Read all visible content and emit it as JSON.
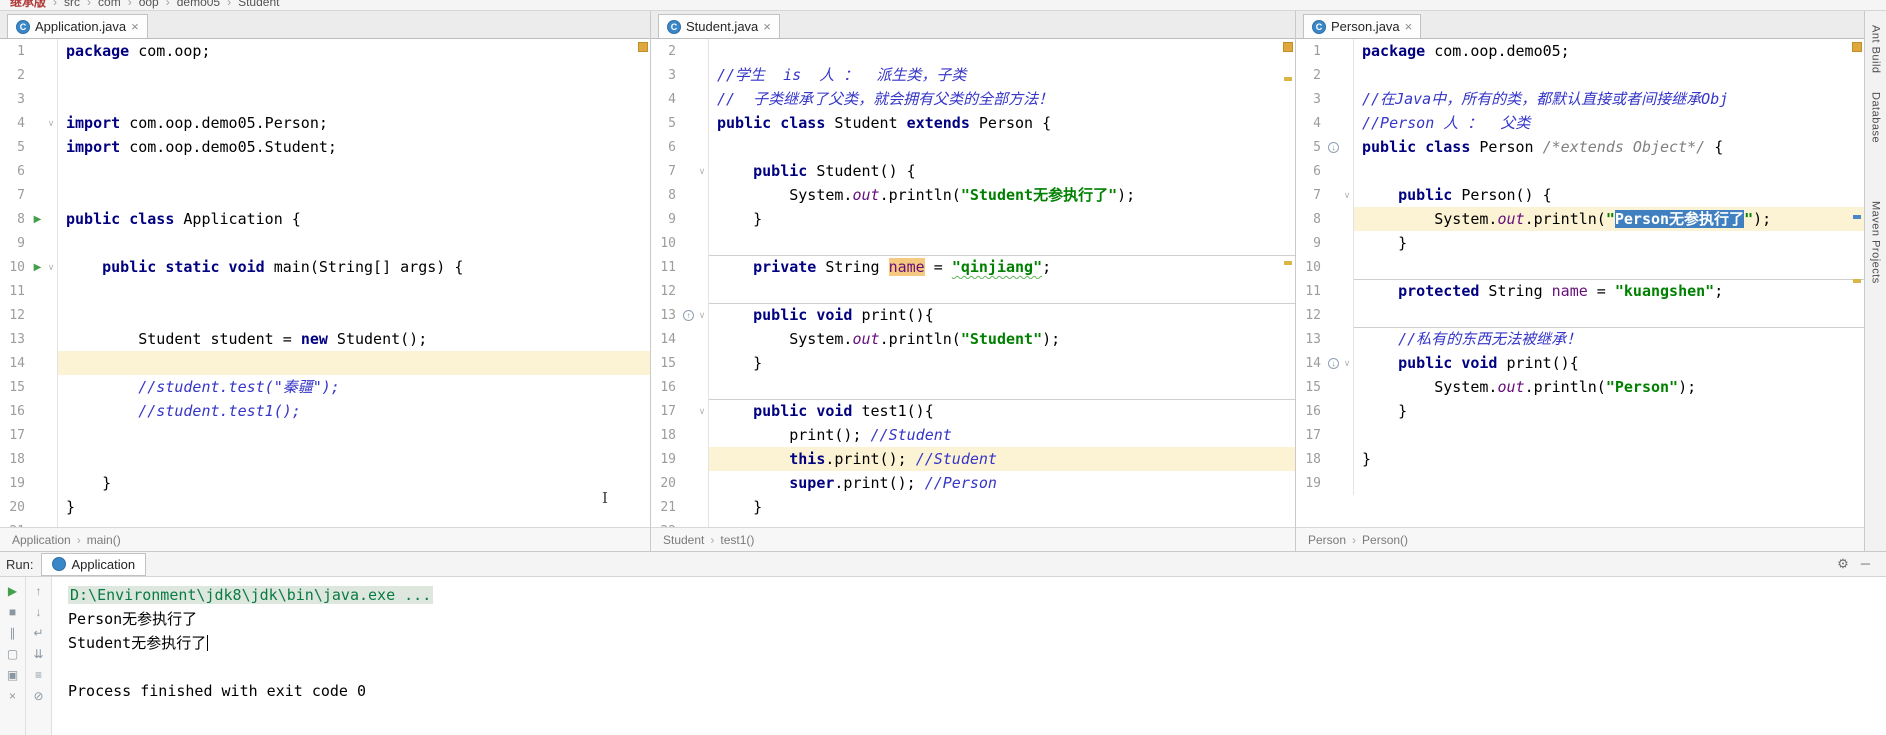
{
  "theme": {
    "keyword_color": "#000080",
    "string_color": "#008000",
    "comment_color": "#3535c8",
    "field_color": "#660e7a",
    "selection_bg": "#4180c0",
    "current_line_bg": "#fcf3d4",
    "identifier_highlight_bg": "#f5c97f",
    "inspection_status_color": "#e0a83c",
    "console_command_color": "#0a7a43"
  },
  "icons": {
    "close": "×",
    "chevron": "›",
    "fold": "∨",
    "gear": "⚙",
    "hide": "─",
    "class_glyph": "C"
  },
  "top_nav": {
    "items": [
      "继承版",
      "src",
      "com",
      "oop",
      "demo05",
      "Student"
    ]
  },
  "gutter_glyphs": {
    "run": "▶",
    "override": "↑",
    "subclass": "↓",
    "overridden": "↓"
  },
  "panes": [
    {
      "tab": "Application.java",
      "start": 1,
      "current_line": 14,
      "breadcrumb": [
        "Application",
        "main()"
      ],
      "gutter_icons": {
        "8": "run",
        "10": "run"
      },
      "folds": [
        4,
        10
      ],
      "separators": [],
      "lines": [
        [
          {
            "t": "package",
            "c": "kw"
          },
          {
            "t": " com.oop;",
            "c": "pl"
          }
        ],
        [],
        [],
        [
          {
            "t": "import",
            "c": "kw"
          },
          {
            "t": " com.oop.demo05.Person;",
            "c": "pl"
          }
        ],
        [
          {
            "t": "import",
            "c": "kw"
          },
          {
            "t": " com.oop.demo05.Student;",
            "c": "pl"
          }
        ],
        [],
        [],
        [
          {
            "t": "public class",
            "c": "kw"
          },
          {
            "t": " Application {",
            "c": "pl"
          }
        ],
        [],
        [
          {
            "t": "    ",
            "c": "pl"
          },
          {
            "t": "public static void",
            "c": "kw"
          },
          {
            "t": " main(String[] args) {",
            "c": "pl"
          }
        ],
        [],
        [],
        [
          {
            "t": "        Student student = ",
            "c": "pl"
          },
          {
            "t": "new",
            "c": "kw"
          },
          {
            "t": " Student();",
            "c": "pl"
          }
        ],
        [],
        [
          {
            "t": "        ",
            "c": "pl"
          },
          {
            "t": "//student.test(\"秦疆\");",
            "c": "cmt"
          }
        ],
        [
          {
            "t": "        ",
            "c": "pl"
          },
          {
            "t": "//student.test1();",
            "c": "cmt"
          }
        ],
        [],
        [],
        [
          {
            "t": "    }",
            "c": "pl"
          }
        ],
        [
          {
            "t": "}",
            "c": "pl"
          }
        ],
        []
      ]
    },
    {
      "tab": "Student.java",
      "start": 2,
      "current_line": 19,
      "breadcrumb": [
        "Student",
        "test1()"
      ],
      "gutter_icons": {
        "13": "override"
      },
      "folds": [
        7,
        13,
        17
      ],
      "separators": [
        11,
        13,
        17
      ],
      "lines": [
        [],
        [
          {
            "t": "//学生  is  人 ：  派生类，子类",
            "c": "cmt"
          }
        ],
        [
          {
            "t": "//  子类继承了父类，就会拥有父类的全部方法！",
            "c": "cmt"
          }
        ],
        [
          {
            "t": "public class",
            "c": "kw"
          },
          {
            "t": " Student ",
            "c": "pl"
          },
          {
            "t": "extends",
            "c": "kw"
          },
          {
            "t": " Person {",
            "c": "pl"
          }
        ],
        [],
        [
          {
            "t": "    ",
            "c": "pl"
          },
          {
            "t": "public",
            "c": "kw"
          },
          {
            "t": " Student() {",
            "c": "pl"
          }
        ],
        [
          {
            "t": "        System.",
            "c": "pl"
          },
          {
            "t": "out",
            "c": "sfld"
          },
          {
            "t": ".println(",
            "c": "pl"
          },
          {
            "t": "\"Student无参执行了\"",
            "c": "str"
          },
          {
            "t": ");",
            "c": "pl"
          }
        ],
        [
          {
            "t": "    }",
            "c": "pl"
          }
        ],
        [],
        [
          {
            "t": "    ",
            "c": "pl"
          },
          {
            "t": "private",
            "c": "kw"
          },
          {
            "t": " String ",
            "c": "pl"
          },
          {
            "t": "name",
            "c": "hl"
          },
          {
            "t": " = ",
            "c": "pl"
          },
          {
            "t": "\"qinjiang\"",
            "c": "typo"
          },
          {
            "t": ";",
            "c": "pl"
          }
        ],
        [],
        [
          {
            "t": "    ",
            "c": "pl"
          },
          {
            "t": "public void",
            "c": "kw"
          },
          {
            "t": " print(){",
            "c": "pl"
          }
        ],
        [
          {
            "t": "        System.",
            "c": "pl"
          },
          {
            "t": "out",
            "c": "sfld"
          },
          {
            "t": ".println(",
            "c": "pl"
          },
          {
            "t": "\"Student\"",
            "c": "str"
          },
          {
            "t": ");",
            "c": "pl"
          }
        ],
        [
          {
            "t": "    }",
            "c": "pl"
          }
        ],
        [],
        [
          {
            "t": "    ",
            "c": "pl"
          },
          {
            "t": "public void",
            "c": "kw"
          },
          {
            "t": " test1(){",
            "c": "pl"
          }
        ],
        [
          {
            "t": "        print(); ",
            "c": "pl"
          },
          {
            "t": "//Student",
            "c": "cmt"
          }
        ],
        [
          {
            "t": "        ",
            "c": "pl"
          },
          {
            "t": "this",
            "c": "kw"
          },
          {
            "t": ".print(); ",
            "c": "pl"
          },
          {
            "t": "//Student",
            "c": "cmt"
          }
        ],
        [
          {
            "t": "        ",
            "c": "pl"
          },
          {
            "t": "super",
            "c": "kw"
          },
          {
            "t": ".print(); ",
            "c": "pl"
          },
          {
            "t": "//Person",
            "c": "cmt"
          }
        ],
        [
          {
            "t": "    }",
            "c": "pl"
          }
        ],
        []
      ]
    },
    {
      "tab": "Person.java",
      "start": 1,
      "current_line": 8,
      "breadcrumb": [
        "Person",
        "Person()"
      ],
      "gutter_icons": {
        "5": "subclass",
        "14": "overridden"
      },
      "folds": [
        7,
        14
      ],
      "separators": [
        11,
        13
      ],
      "lines": [
        [
          {
            "t": "package",
            "c": "kw"
          },
          {
            "t": " com.oop.demo05;",
            "c": "pl"
          }
        ],
        [],
        [
          {
            "t": "//在Java中，所有的类，都默认直接或者间接继承Obj",
            "c": "cmt"
          }
        ],
        [
          {
            "t": "//Person 人 ：  父类",
            "c": "cmt"
          }
        ],
        [
          {
            "t": "public class",
            "c": "kw"
          },
          {
            "t": " Person ",
            "c": "pl"
          },
          {
            "t": "/*extends Object*/",
            "c": "cmt2"
          },
          {
            "t": " {",
            "c": "pl"
          }
        ],
        [],
        [
          {
            "t": "    ",
            "c": "pl"
          },
          {
            "t": "public",
            "c": "kw"
          },
          {
            "t": " Person() {",
            "c": "pl"
          }
        ],
        [
          {
            "t": "        System.",
            "c": "pl"
          },
          {
            "t": "out",
            "c": "sfld"
          },
          {
            "t": ".println(",
            "c": "pl"
          },
          {
            "t": "\"",
            "c": "str"
          },
          {
            "t": "Person无参执行了",
            "c": "sel"
          },
          {
            "t": "\"",
            "c": "str"
          },
          {
            "t": ");",
            "c": "pl"
          }
        ],
        [
          {
            "t": "    }",
            "c": "pl"
          }
        ],
        [],
        [
          {
            "t": "    ",
            "c": "pl"
          },
          {
            "t": "protected",
            "c": "kw"
          },
          {
            "t": " String ",
            "c": "pl"
          },
          {
            "t": "name",
            "c": "fld"
          },
          {
            "t": " = ",
            "c": "pl"
          },
          {
            "t": "\"kuangshen\"",
            "c": "str"
          },
          {
            "t": ";",
            "c": "pl"
          }
        ],
        [],
        [
          {
            "t": "    ",
            "c": "pl"
          },
          {
            "t": "//私有的东西无法被继承！",
            "c": "cmt"
          }
        ],
        [
          {
            "t": "    ",
            "c": "pl"
          },
          {
            "t": "public void",
            "c": "kw"
          },
          {
            "t": " print(){",
            "c": "pl"
          }
        ],
        [
          {
            "t": "        System.",
            "c": "pl"
          },
          {
            "t": "out",
            "c": "sfld"
          },
          {
            "t": ".println(",
            "c": "pl"
          },
          {
            "t": "\"Person\"",
            "c": "str"
          },
          {
            "t": ");",
            "c": "pl"
          }
        ],
        [
          {
            "t": "    }",
            "c": "pl"
          }
        ],
        [],
        [
          {
            "t": "}",
            "c": "pl"
          }
        ],
        []
      ]
    }
  ],
  "run": {
    "label": "Run:",
    "tab": "Application",
    "output": [
      {
        "text": "D:\\Environment\\jdk8\\jdk\\bin\\java.exe ...",
        "style": "cmd"
      },
      {
        "text": "Person无参执行了",
        "style": "std"
      },
      {
        "text": "Student无参执行了",
        "style": "std",
        "caret": true
      },
      {
        "text": "",
        "style": "std"
      },
      {
        "text": "Process finished with exit code 0",
        "style": "std"
      }
    ],
    "left_icons": [
      {
        "name": "rerun-icon",
        "glyph": "▶",
        "cls": "green"
      },
      {
        "name": "stop-icon",
        "glyph": "■"
      },
      {
        "name": "pause-output-icon",
        "glyph": "∥"
      },
      {
        "name": "restore-layout-icon",
        "glyph": "▢"
      },
      {
        "name": "pin-tab-icon",
        "glyph": "▣"
      },
      {
        "name": "close-icon",
        "glyph": "×"
      }
    ],
    "console_icons": [
      {
        "name": "up-stack-trace-icon",
        "glyph": "↑"
      },
      {
        "name": "down-stack-trace-icon",
        "glyph": "↓"
      },
      {
        "name": "soft-wrap-icon",
        "glyph": "↵"
      },
      {
        "name": "scroll-to-end-icon",
        "glyph": "⇊"
      },
      {
        "name": "print-icon",
        "glyph": "≡"
      },
      {
        "name": "clear-all-icon",
        "glyph": "⊘"
      }
    ]
  },
  "right_strip": {
    "labels": [
      "Ant Build",
      "Database",
      "Maven Projects"
    ]
  },
  "cursor": {
    "ibeam": "I"
  }
}
